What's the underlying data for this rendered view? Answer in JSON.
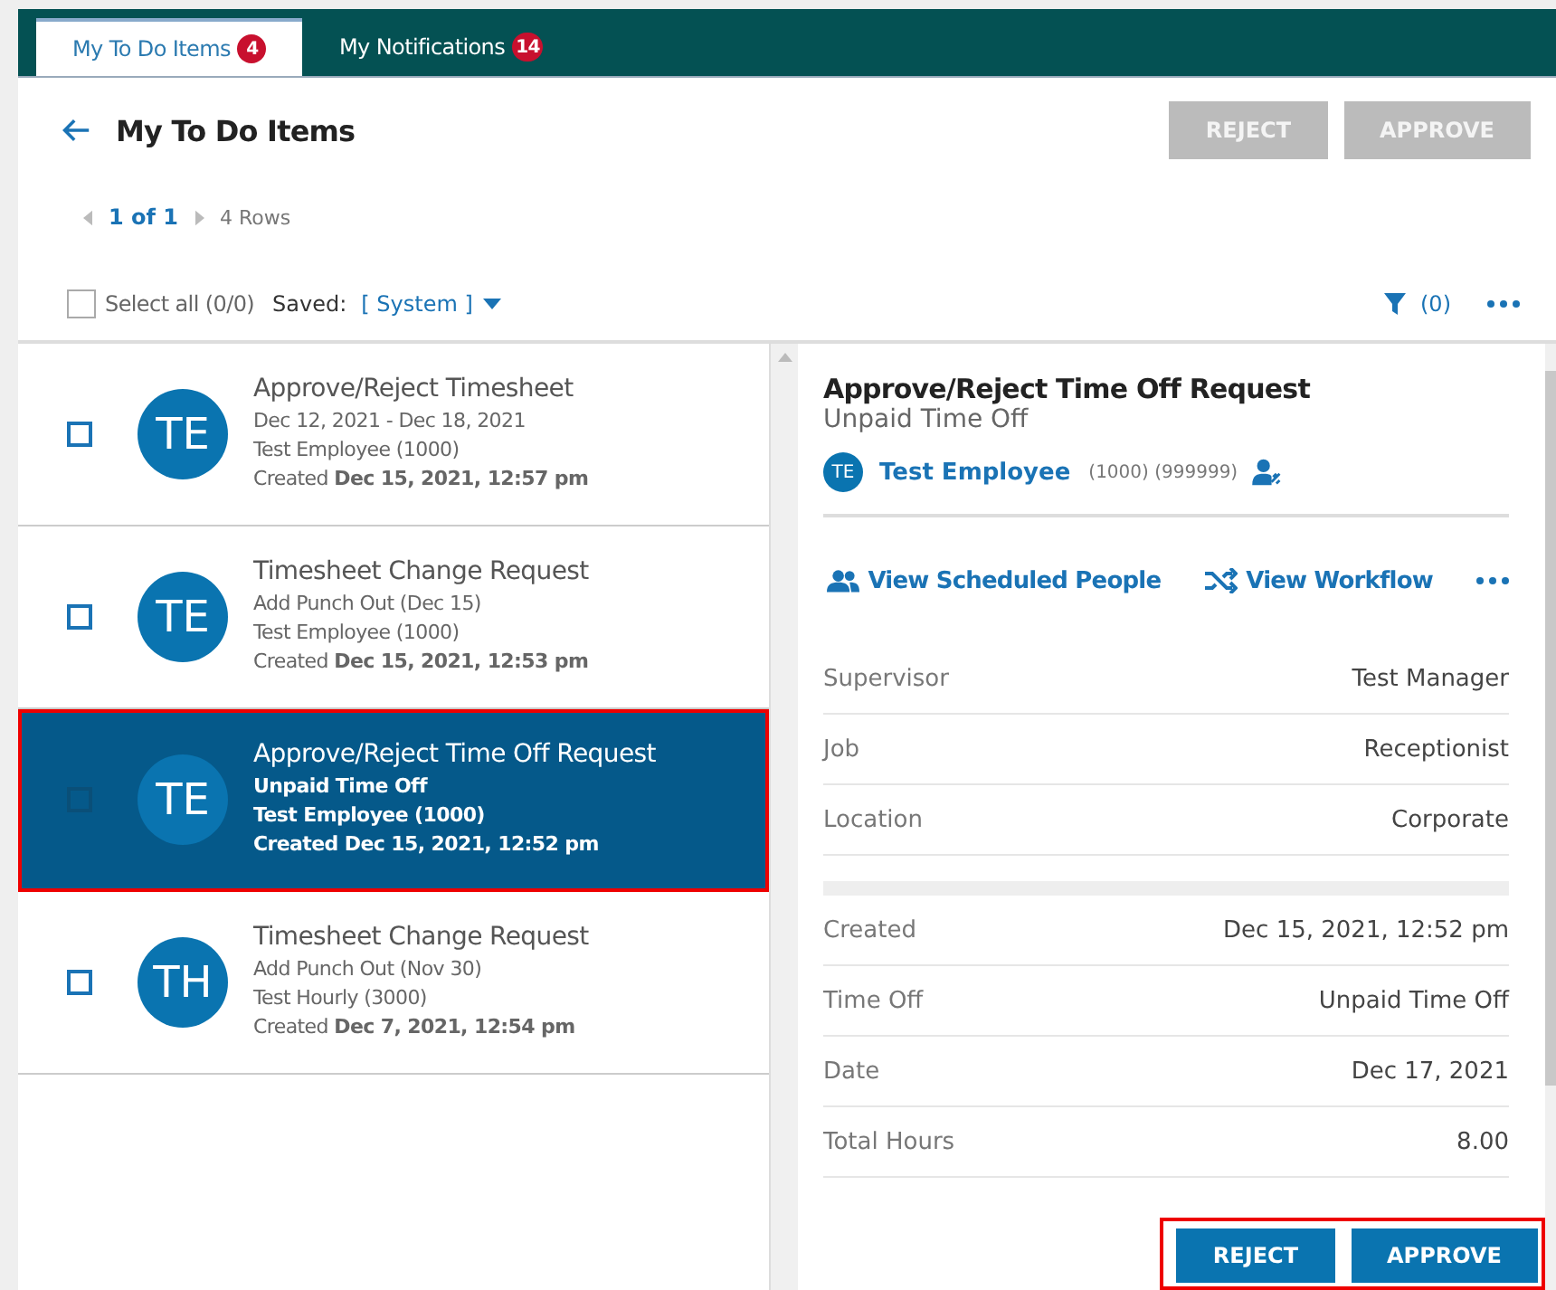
{
  "tabs": [
    {
      "label": "My To Do Items",
      "badge": "4",
      "selected": true
    },
    {
      "label": "My Notifications",
      "badge": "14",
      "selected": false
    }
  ],
  "header": {
    "title": "My To Do Items",
    "buttons": [
      {
        "label": "REJECT",
        "disabled": true
      },
      {
        "label": "APPROVE",
        "disabled": true
      }
    ]
  },
  "pager": {
    "page": "1 of 1",
    "rows": "4 Rows"
  },
  "toolbar": {
    "select_all": "Select all (0/0)",
    "saved_label": "Saved:",
    "saved_value": "[ System ]",
    "filter": "(0)",
    "select_all_checked": false
  },
  "items": [
    {
      "initials": "TE",
      "title": "Approve/Reject Timesheet",
      "lines": [
        "Dec 12, 2021 - Dec 18, 2021",
        "Test Employee (1000)",
        "Created **Dec 15, 2021, 12:57 pm**"
      ],
      "selected": false,
      "checked": false
    },
    {
      "initials": "TE",
      "title": "Timesheet Change Request",
      "lines": [
        "Add Punch Out (Dec 15)",
        "Test Employee (1000)",
        "Created **Dec 15, 2021, 12:53 pm**"
      ],
      "selected": false,
      "checked": false
    },
    {
      "initials": "TE",
      "title": "Approve/Reject Time Off Request",
      "lines": [
        "Unpaid Time Off",
        "Test Employee (1000)",
        "Created **Dec 15, 2021, 12:52 pm**"
      ],
      "selected": true,
      "checked": false
    },
    {
      "initials": "TH",
      "title": "Timesheet Change Request",
      "lines": [
        "Add Punch Out (Nov 30)",
        "Test Hourly (3000)",
        "Created **Dec 7, 2021, 12:54 pm**"
      ],
      "selected": false,
      "checked": false
    }
  ],
  "detail": {
    "title": "Approve/Reject Time Off Request",
    "subtitle": "Unpaid Time Off",
    "initials": "TE",
    "employee": "Test Employee",
    "ids": "(1000) (999999)",
    "actions": [
      "View Scheduled People",
      "View Workflow"
    ],
    "fields": [
      {
        "label": "Supervisor",
        "value": "Test Manager"
      },
      {
        "label": "Job",
        "value": "Receptionist"
      },
      {
        "label": "Location",
        "value": "Corporate"
      }
    ],
    "fields2": [
      {
        "label": "Created",
        "value": "Dec 15, 2021, 12:52 pm"
      },
      {
        "label": "Time Off",
        "value": "Unpaid Time Off"
      },
      {
        "label": "Date",
        "value": "Dec 17, 2021"
      },
      {
        "label": "Total Hours",
        "value": "8.00"
      }
    ],
    "buttons": [
      {
        "label": "REJECT",
        "disabled": false
      },
      {
        "label": "APPROVE",
        "disabled": false
      }
    ],
    "buttons_framed": true
  }
}
